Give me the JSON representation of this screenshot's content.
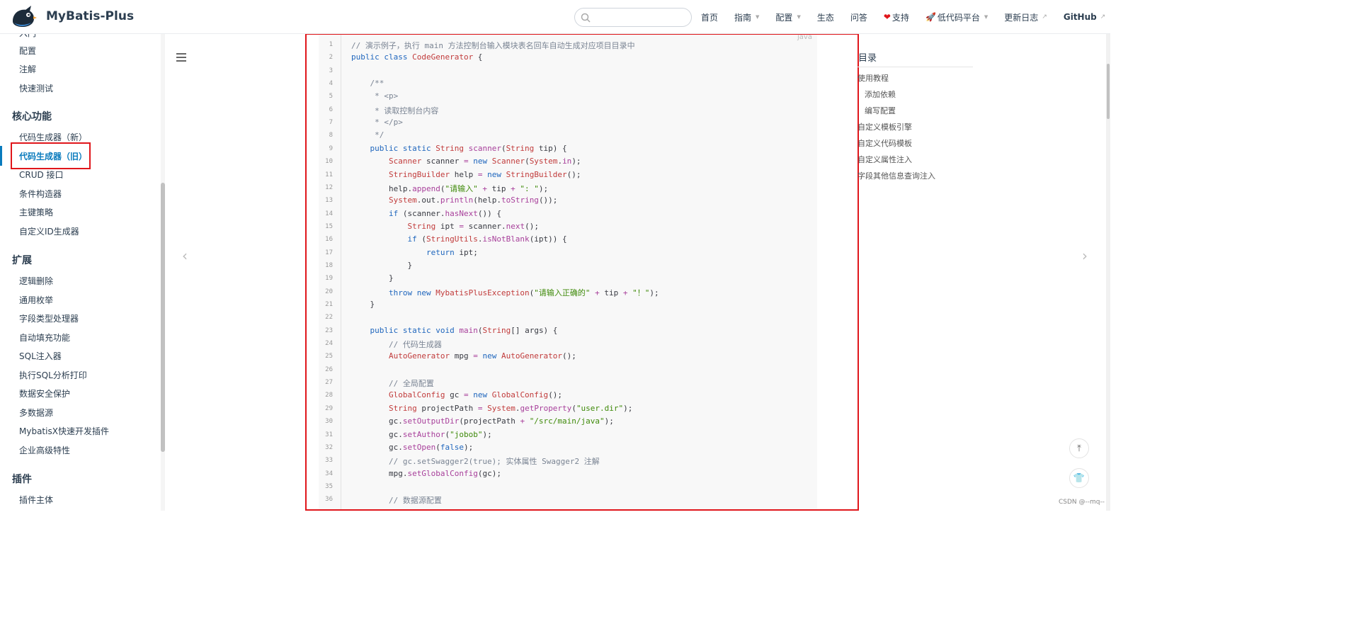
{
  "header": {
    "title": "MyBatis-Plus",
    "logo_icon": "bird-logo-icon",
    "search": {
      "value": "",
      "placeholder": ""
    },
    "nav": [
      {
        "label": "首页"
      },
      {
        "label": "指南",
        "dropdown": true
      },
      {
        "label": "配置",
        "dropdown": true
      },
      {
        "label": "生态"
      },
      {
        "label": "问答"
      },
      {
        "label": "支持",
        "icon": "heart-icon"
      },
      {
        "label": "低代码平台",
        "icon": "rocket-icon",
        "dropdown": true
      },
      {
        "label": "更新日志",
        "external": true
      },
      {
        "label": "GitHub",
        "external": true
      }
    ]
  },
  "sidebar": {
    "partial_top_item": "入门",
    "top_items": [
      "配置",
      "注解",
      "快速测试"
    ],
    "groups": [
      {
        "title": "核心功能",
        "items": [
          "代码生成器（新）",
          "代码生成器（旧）",
          "CRUD 接口",
          "条件构造器",
          "主键策略",
          "自定义ID生成器"
        ]
      },
      {
        "title": "扩展",
        "items": [
          "逻辑删除",
          "通用枚举",
          "字段类型处理器",
          "自动填充功能",
          "SQL注入器",
          "执行SQL分析打印",
          "数据安全保护",
          "多数据源",
          "MybatisX快速开发插件",
          "企业高级特性"
        ]
      },
      {
        "title": "插件",
        "items": [
          "插件主体"
        ]
      }
    ],
    "active_item": "代码生成器（旧）",
    "accent_color": "#0a7bbd"
  },
  "code": {
    "language": "java",
    "lines": [
      {
        "n": "1",
        "t": [
          [
            "cm",
            "// 演示例子，执行 main 方法控制台输入模块表名回车自动生成对应项目目录中"
          ]
        ]
      },
      {
        "n": "2",
        "t": [
          [
            "kw",
            "public class "
          ],
          [
            "ty",
            "CodeGenerator"
          ],
          [
            "tx",
            " {"
          ]
        ]
      },
      {
        "n": "3",
        "t": []
      },
      {
        "n": "4",
        "t": [
          [
            "cm",
            "    /**"
          ]
        ]
      },
      {
        "n": "5",
        "t": [
          [
            "cm",
            "     * <p>"
          ]
        ]
      },
      {
        "n": "6",
        "t": [
          [
            "cm",
            "     * 读取控制台内容"
          ]
        ]
      },
      {
        "n": "7",
        "t": [
          [
            "cm",
            "     * </p>"
          ]
        ]
      },
      {
        "n": "8",
        "t": [
          [
            "cm",
            "     */"
          ]
        ]
      },
      {
        "n": "9",
        "t": [
          [
            "kw",
            "    public static "
          ],
          [
            "ty",
            "String "
          ],
          [
            "fn",
            "scanner"
          ],
          [
            "tx",
            "("
          ],
          [
            "ty",
            "String "
          ],
          [
            "tx",
            "tip) {"
          ]
        ]
      },
      {
        "n": "10",
        "t": [
          [
            "ty",
            "        Scanner "
          ],
          [
            "tx",
            "scanner "
          ],
          [
            "fn",
            "= "
          ],
          [
            "kw",
            "new "
          ],
          [
            "ty",
            "Scanner"
          ],
          [
            "tx",
            "("
          ],
          [
            "ty",
            "System"
          ],
          [
            "tx",
            "."
          ],
          [
            "fn",
            "in"
          ],
          [
            "tx",
            ");"
          ]
        ]
      },
      {
        "n": "11",
        "t": [
          [
            "ty",
            "        StringBuilder "
          ],
          [
            "tx",
            "help "
          ],
          [
            "fn",
            "= "
          ],
          [
            "kw",
            "new "
          ],
          [
            "ty",
            "StringBuilder"
          ],
          [
            "tx",
            "();"
          ]
        ]
      },
      {
        "n": "12",
        "t": [
          [
            "tx",
            "        help."
          ],
          [
            "fn",
            "append"
          ],
          [
            "tx",
            "("
          ],
          [
            "st",
            "\"请输入\""
          ],
          [
            "fn",
            " + "
          ],
          [
            "tx",
            "tip "
          ],
          [
            "fn",
            "+ "
          ],
          [
            "st",
            "\": \""
          ],
          [
            "tx",
            ");"
          ]
        ]
      },
      {
        "n": "13",
        "t": [
          [
            "ty",
            "        System"
          ],
          [
            "tx",
            ".out."
          ],
          [
            "fn",
            "println"
          ],
          [
            "tx",
            "(help."
          ],
          [
            "fn",
            "toString"
          ],
          [
            "tx",
            "());"
          ]
        ]
      },
      {
        "n": "14",
        "t": [
          [
            "kw",
            "        if "
          ],
          [
            "tx",
            "(scanner."
          ],
          [
            "fn",
            "hasNext"
          ],
          [
            "tx",
            "()) {"
          ]
        ]
      },
      {
        "n": "15",
        "t": [
          [
            "ty",
            "            String "
          ],
          [
            "tx",
            "ipt "
          ],
          [
            "fn",
            "= "
          ],
          [
            "tx",
            "scanner."
          ],
          [
            "fn",
            "next"
          ],
          [
            "tx",
            "();"
          ]
        ]
      },
      {
        "n": "16",
        "t": [
          [
            "kw",
            "            if "
          ],
          [
            "tx",
            "("
          ],
          [
            "ty",
            "StringUtils"
          ],
          [
            "tx",
            "."
          ],
          [
            "fn",
            "isNotBlank"
          ],
          [
            "tx",
            "(ipt)) {"
          ]
        ]
      },
      {
        "n": "17",
        "t": [
          [
            "kw",
            "                return "
          ],
          [
            "tx",
            "ipt;"
          ]
        ]
      },
      {
        "n": "18",
        "t": [
          [
            "tx",
            "            }"
          ]
        ]
      },
      {
        "n": "19",
        "t": [
          [
            "tx",
            "        }"
          ]
        ]
      },
      {
        "n": "20",
        "t": [
          [
            "kw",
            "        throw new "
          ],
          [
            "ty",
            "MybatisPlusException"
          ],
          [
            "tx",
            "("
          ],
          [
            "st",
            "\"请输入正确的\""
          ],
          [
            "fn",
            " + "
          ],
          [
            "tx",
            "tip "
          ],
          [
            "fn",
            "+ "
          ],
          [
            "st",
            "\"！\""
          ],
          [
            "tx",
            ");"
          ]
        ]
      },
      {
        "n": "21",
        "t": [
          [
            "tx",
            "    }"
          ]
        ]
      },
      {
        "n": "22",
        "t": []
      },
      {
        "n": "23",
        "t": [
          [
            "kw",
            "    public static void "
          ],
          [
            "fn",
            "main"
          ],
          [
            "tx",
            "("
          ],
          [
            "ty",
            "String"
          ],
          [
            "tx",
            "[] args) {"
          ]
        ]
      },
      {
        "n": "24",
        "t": [
          [
            "cm",
            "        // 代码生成器"
          ]
        ]
      },
      {
        "n": "25",
        "t": [
          [
            "ty",
            "        AutoGenerator "
          ],
          [
            "tx",
            "mpg "
          ],
          [
            "fn",
            "= "
          ],
          [
            "kw",
            "new "
          ],
          [
            "ty",
            "AutoGenerator"
          ],
          [
            "tx",
            "();"
          ]
        ]
      },
      {
        "n": "26",
        "t": []
      },
      {
        "n": "27",
        "t": [
          [
            "cm",
            "        // 全局配置"
          ]
        ]
      },
      {
        "n": "28",
        "t": [
          [
            "ty",
            "        GlobalConfig "
          ],
          [
            "tx",
            "gc "
          ],
          [
            "fn",
            "= "
          ],
          [
            "kw",
            "new "
          ],
          [
            "ty",
            "GlobalConfig"
          ],
          [
            "tx",
            "();"
          ]
        ]
      },
      {
        "n": "29",
        "t": [
          [
            "ty",
            "        String "
          ],
          [
            "tx",
            "projectPath "
          ],
          [
            "fn",
            "= "
          ],
          [
            "ty",
            "System"
          ],
          [
            "tx",
            "."
          ],
          [
            "fn",
            "getProperty"
          ],
          [
            "tx",
            "("
          ],
          [
            "st",
            "\"user.dir\""
          ],
          [
            "tx",
            ");"
          ]
        ]
      },
      {
        "n": "30",
        "t": [
          [
            "tx",
            "        gc."
          ],
          [
            "fn",
            "setOutputDir"
          ],
          [
            "tx",
            "(projectPath "
          ],
          [
            "fn",
            "+ "
          ],
          [
            "st",
            "\"/src/main/java\""
          ],
          [
            "tx",
            ");"
          ]
        ]
      },
      {
        "n": "31",
        "t": [
          [
            "tx",
            "        gc."
          ],
          [
            "fn",
            "setAuthor"
          ],
          [
            "tx",
            "("
          ],
          [
            "st",
            "\"jobob\""
          ],
          [
            "tx",
            ");"
          ]
        ]
      },
      {
        "n": "32",
        "t": [
          [
            "tx",
            "        gc."
          ],
          [
            "fn",
            "setOpen"
          ],
          [
            "tx",
            "("
          ],
          [
            "kw",
            "false"
          ],
          [
            "tx",
            ");"
          ]
        ]
      },
      {
        "n": "33",
        "t": [
          [
            "cm",
            "        // gc.setSwagger2(true); 实体属性 Swagger2 注解"
          ]
        ]
      },
      {
        "n": "34",
        "t": [
          [
            "tx",
            "        mpg."
          ],
          [
            "fn",
            "setGlobalConfig"
          ],
          [
            "tx",
            "(gc);"
          ]
        ]
      },
      {
        "n": "35",
        "t": []
      },
      {
        "n": "36",
        "t": [
          [
            "cm",
            "        // 数据源配置"
          ]
        ]
      }
    ]
  },
  "toc": {
    "title": "目录",
    "items": [
      {
        "label": "使用教程",
        "level": 1
      },
      {
        "label": "添加依赖",
        "level": 2
      },
      {
        "label": "编写配置",
        "level": 2
      },
      {
        "label": "自定义模板引擎",
        "level": 1
      },
      {
        "label": "自定义代码模板",
        "level": 1
      },
      {
        "label": "自定义属性注入",
        "level": 1
      },
      {
        "label": "字段其他信息查询注入",
        "level": 1
      }
    ]
  },
  "watermark": "CSDN @--mq--",
  "colors": {
    "highlight_box": "#e0161b",
    "link": "#0a7bbd"
  }
}
